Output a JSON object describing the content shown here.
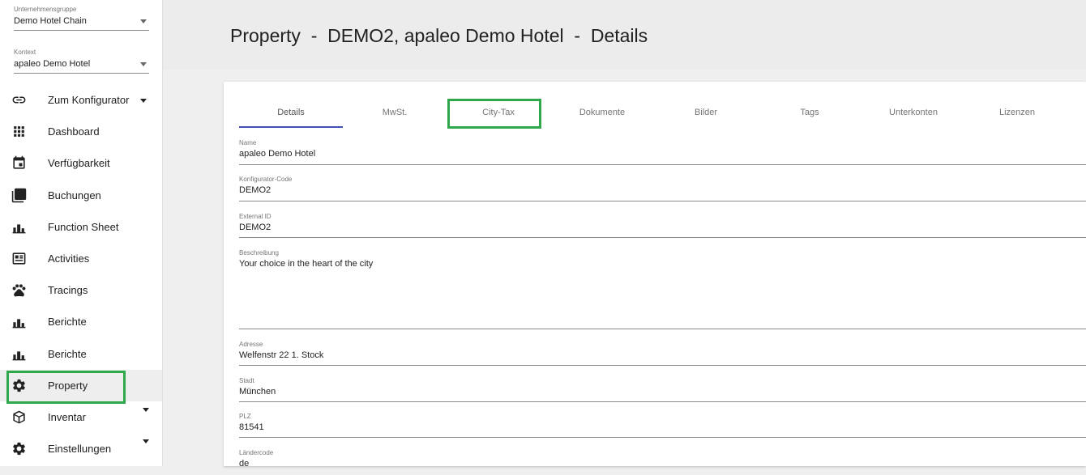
{
  "sidebar": {
    "company_group": {
      "label": "Unternehmensgruppe",
      "value": "Demo Hotel Chain"
    },
    "context": {
      "label": "Kontext",
      "value": "apaleo Demo Hotel"
    },
    "items": [
      {
        "label": "Zum Konfigurator",
        "icon": "link-icon",
        "has_caret": true
      },
      {
        "label": "Dashboard",
        "icon": "apps-grid-icon"
      },
      {
        "label": "Verfügbarkeit",
        "icon": "calendar-icon"
      },
      {
        "label": "Buchungen",
        "icon": "stack-icon"
      },
      {
        "label": "Function Sheet",
        "icon": "bar-chart-icon"
      },
      {
        "label": "Activities",
        "icon": "newspaper-icon"
      },
      {
        "label": "Tracings",
        "icon": "paw-icon"
      },
      {
        "label": "Berichte",
        "icon": "bar-chart-icon"
      },
      {
        "label": "Berichte",
        "icon": "bar-chart-icon"
      },
      {
        "label": "Property",
        "icon": "gear-icon",
        "active": true,
        "highlighted": true
      },
      {
        "label": "Inventar",
        "icon": "cube-icon",
        "has_caret": true
      },
      {
        "label": "Einstellungen",
        "icon": "gear-icon",
        "has_caret": true
      }
    ]
  },
  "header": {
    "title": "Property  -  DEMO2, apaleo Demo Hotel  -  Details"
  },
  "tabs": [
    {
      "label": "Details",
      "active": true
    },
    {
      "label": "MwSt."
    },
    {
      "label": "City-Tax",
      "highlighted": true
    },
    {
      "label": "Dokumente"
    },
    {
      "label": "Bilder"
    },
    {
      "label": "Tags"
    },
    {
      "label": "Unterkonten"
    },
    {
      "label": "Lizenzen"
    }
  ],
  "form": {
    "name": {
      "label": "Name",
      "value": "apaleo Demo Hotel"
    },
    "code": {
      "label": "Konfigurator-Code",
      "value": "DEMO2"
    },
    "external_id": {
      "label": "External ID",
      "value": "DEMO2"
    },
    "description": {
      "label": "Beschreibung",
      "value": "Your choice in the heart of the city"
    },
    "address": {
      "label": "Adresse",
      "value": "Welfenstr 22 1. Stock"
    },
    "city": {
      "label": "Stadt",
      "value": "München"
    },
    "zip": {
      "label": "PLZ",
      "value": "81541"
    },
    "country_code": {
      "label": "Ländercode",
      "value": "de"
    }
  },
  "colors": {
    "highlight": "#2ea84a",
    "tab_indicator": "#3f51b5"
  }
}
